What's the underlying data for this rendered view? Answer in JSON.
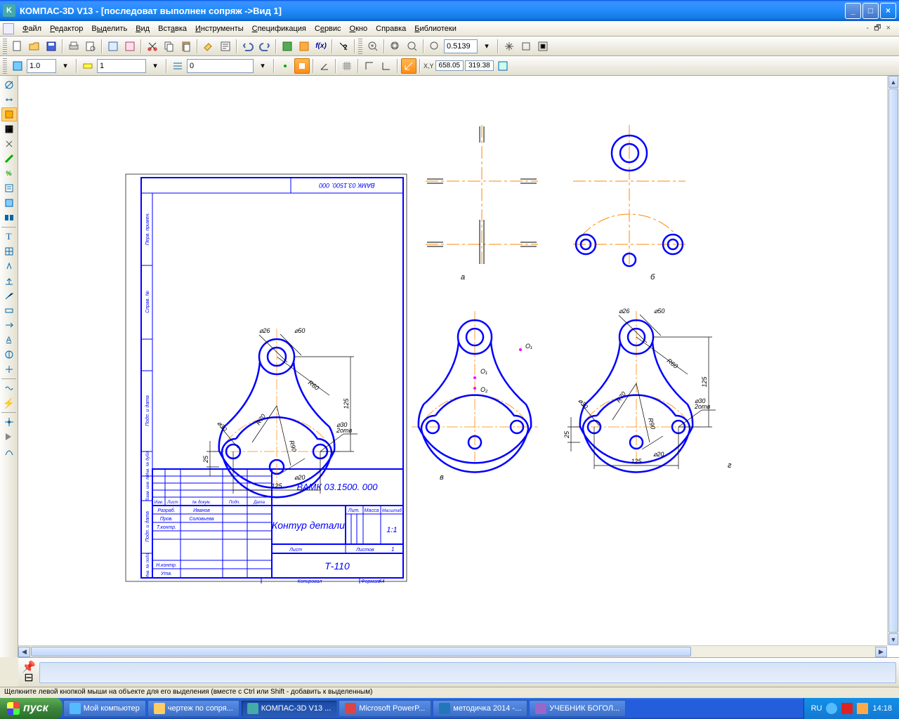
{
  "window": {
    "title": "КОМПАС-3D V13  -  [последоват выполнен сопряж ->Вид 1]"
  },
  "menu": {
    "file": "Файл",
    "edit": "Редактор",
    "select": "Выделить",
    "view": "Вид",
    "insert": "Вставка",
    "tools": "Инструменты",
    "spec": "Спецификация",
    "service": "Сервис",
    "window": "Окно",
    "help": "Справка",
    "libs": "Библиотеки"
  },
  "toolbar2": {
    "zoom_value": "0.5139"
  },
  "toolbar3": {
    "scale": "1.0",
    "layer": "1",
    "style": "0",
    "coord_x": "658.05",
    "coord_y": "319.38"
  },
  "status": {
    "text": "Щелкните левой кнопкой мыши на объекте для его выделения (вместе с Ctrl или Shift - добавить к выделенным)"
  },
  "drawing": {
    "code_top": "ВАМК 03.1500. 000",
    "code": "ВАМК 03.1500. 000",
    "title": "Контур детали",
    "group": "Т-110",
    "scale": "1:1",
    "format": "А4",
    "sheets_label": "Листов",
    "sheet_label": "Лист",
    "sheets": "1",
    "copied": "Копировал",
    "mass": "Масса",
    "scale_h": "Масштаб",
    "lit": "Лит.",
    "dev": "Разраб.",
    "chk": "Пров.",
    "tctrl": "Т.контр.",
    "nctrl": "Н.контр.",
    "appr": "Утв.",
    "dev_name": "Иванов",
    "chk_name": "Соловьева",
    "col_izm": "Изм.",
    "col_list": "Лист",
    "col_doc": "№ докум.",
    "col_sign": "Подп.",
    "col_date": "Дата",
    "side1": "Перв. примен.",
    "side2": "Справ. №",
    "side3": "Подп. и дата",
    "side4": "Инв. № дубл.",
    "side5": "Взам. инв. №",
    "side6": "Подп. и дата",
    "side7": "Инв. № подл.",
    "dims": {
      "d26": "⌀26",
      "d50": "⌀50",
      "d30": "⌀30",
      "d20": "⌀20",
      "r60": "R60",
      "r70": "R70",
      "r90": "R90",
      "w125": "125",
      "h125": "125",
      "h25": "25",
      "holes": "2отв"
    },
    "labels": {
      "a": "а",
      "b": "б",
      "v": "в",
      "g": "г",
      "o1": "О₁",
      "o2": "О₂"
    }
  },
  "taskbar": {
    "start": "пуск",
    "items": [
      {
        "label": "Мой компьютер"
      },
      {
        "label": "чертеж по сопря..."
      },
      {
        "label": "КОМПАС-3D V13 ..."
      },
      {
        "label": "Microsoft PowerP..."
      },
      {
        "label": "методичка 2014 -..."
      },
      {
        "label": "УЧЕБНИК БОГОЛ..."
      }
    ],
    "lang": "RU",
    "time": "14:18"
  }
}
